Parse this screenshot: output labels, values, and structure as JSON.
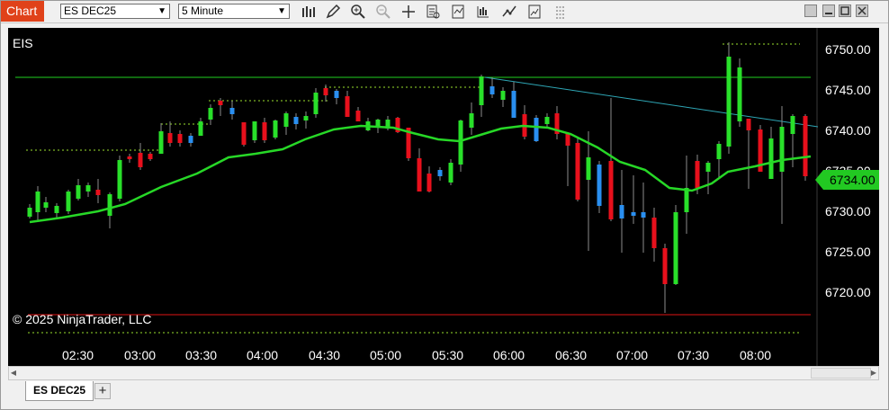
{
  "toolbar": {
    "chart_label": "Chart",
    "instrument": "ES DEC25",
    "interval": "5 Minute",
    "icons": [
      "bars-type-icon",
      "draw-pencil-icon",
      "zoom-in-icon",
      "zoom-out-icon",
      "crosshair-icon",
      "data-box-icon",
      "indicators-icon",
      "strategies-icon",
      "drawing-tools-icon",
      "properties-icon",
      "share-icon"
    ],
    "window_buttons": [
      "tile-icon",
      "minimize-icon",
      "maximize-icon",
      "close-icon"
    ]
  },
  "chart": {
    "symbol_label": "EIS",
    "copyright": "© 2025 NinjaTrader, LLC",
    "price_marker": "6734.00",
    "colors": {
      "up": "#29e02a",
      "down": "#e8101c",
      "doji": "#2a8ff0",
      "ma": "#27d827",
      "resistance": "#1fd01f",
      "support": "#e01515",
      "trend": "#2ea6b5",
      "marker": "#22c922"
    },
    "y_ticks": [
      "6750.00",
      "6745.00",
      "6740.00",
      "6735.00",
      "6730.00",
      "6725.00",
      "6720.00"
    ],
    "x_ticks": [
      "02:30",
      "03:00",
      "03:30",
      "04:00",
      "04:30",
      "05:00",
      "05:30",
      "06:00",
      "06:30",
      "07:00",
      "07:30",
      "08:00"
    ]
  },
  "tabs": [
    {
      "label": "ES DEC25"
    }
  ],
  "tab_add_label": "+"
}
